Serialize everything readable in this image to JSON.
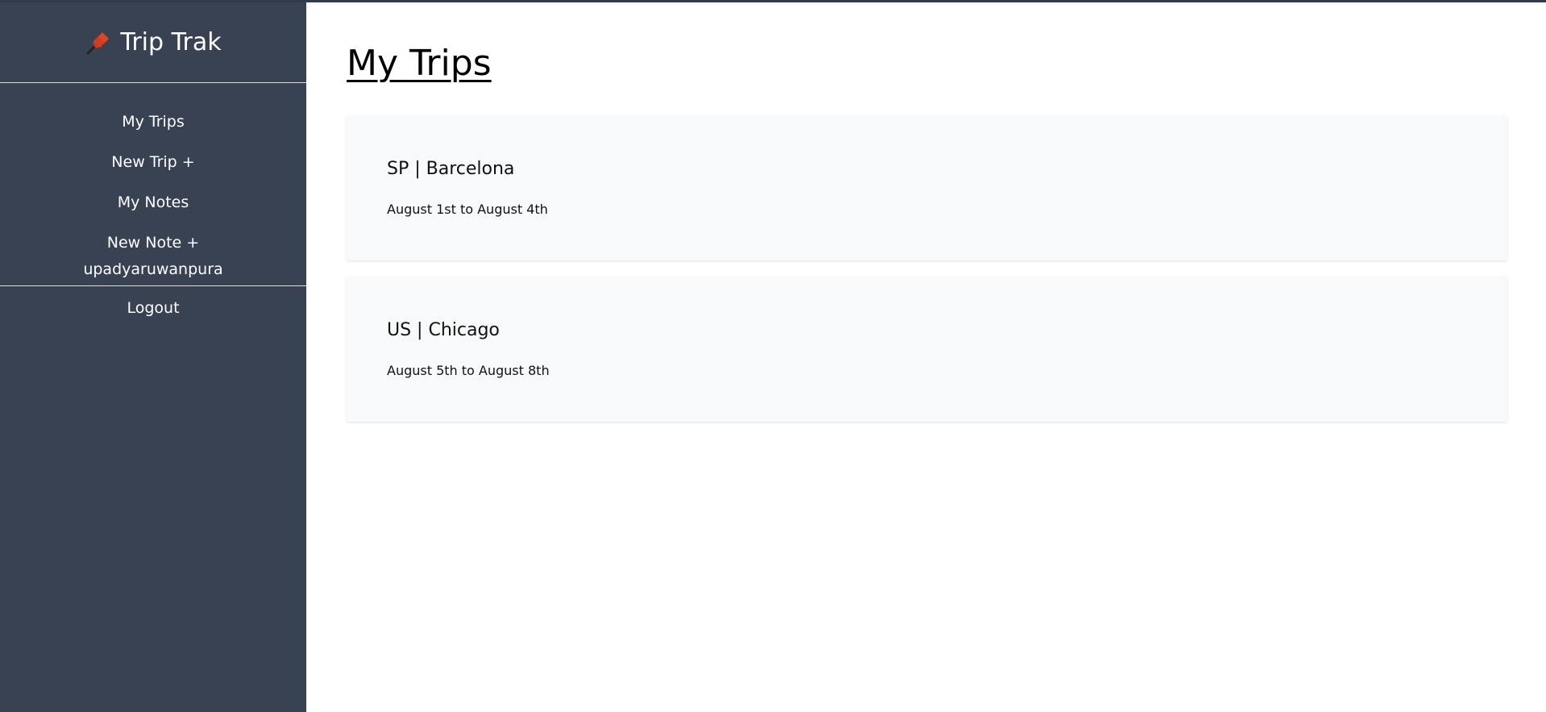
{
  "app": {
    "brand_title": "Trip Trak",
    "brand_icon": "pushpin-icon",
    "accent_color": "#394252"
  },
  "sidebar": {
    "items": [
      {
        "label": "My Trips"
      },
      {
        "label": "New Trip +"
      },
      {
        "label": "My Notes"
      },
      {
        "label": "New Note +"
      }
    ],
    "username": "upadyaruwanpura",
    "logout_label": "Logout"
  },
  "main": {
    "page_title": "My Trips",
    "trips": [
      {
        "name": "SP | Barcelona",
        "dates": "August 1st to August 4th"
      },
      {
        "name": "US | Chicago",
        "dates": "August 5th to August 8th"
      }
    ]
  }
}
